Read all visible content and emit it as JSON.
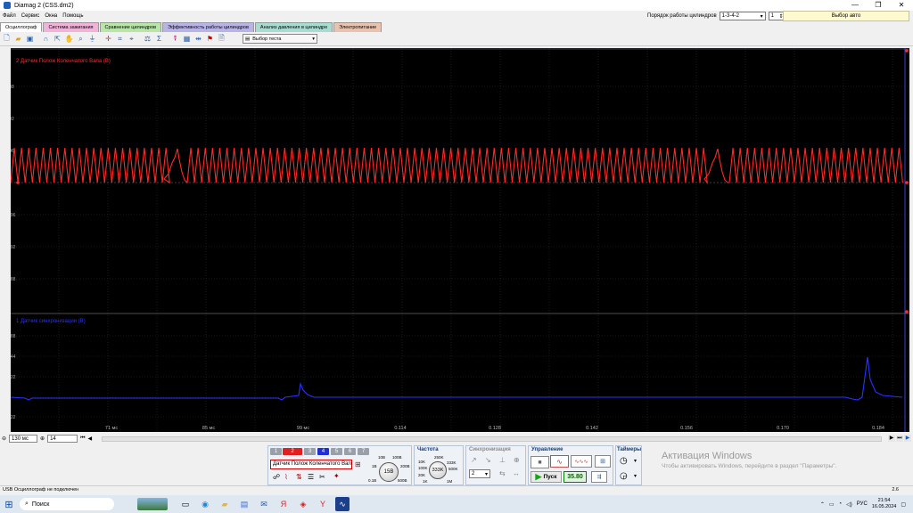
{
  "window": {
    "title": "Diamag 2 (CSS.dm2)",
    "minimize": "—",
    "maximize": "❐",
    "close": "✕"
  },
  "menu": [
    "Файл",
    "Сервис",
    "Окна",
    "Помощь"
  ],
  "cylinder_order": {
    "label": "Порядок работы цилиндров",
    "value": "1-3-4-2",
    "cyl_value": "1"
  },
  "auto_select": "Выбор авто",
  "tabs": [
    {
      "label": "Осциллограф",
      "bg": "#ffffff"
    },
    {
      "label": "Система зажигания",
      "bg": "#f0b4d8"
    },
    {
      "label": "Сравнение цилиндров",
      "bg": "#b8e6a8"
    },
    {
      "label": "Эффективность работы цилиндров",
      "bg": "#b8b4e6"
    },
    {
      "label": "Анализ давления в цилиндре",
      "bg": "#a8dcd0"
    },
    {
      "label": "Электропитание",
      "bg": "#e8c4b0"
    }
  ],
  "toolbar": {
    "test_select": "Выбор теста"
  },
  "scope": {
    "ch1": {
      "label": "2 Датчик Полож Коленчатого Вала (В)",
      "color": "#ff2020",
      "y_ticks": [
        "9.88",
        "5.92",
        "2.96",
        "0",
        "-2.96",
        "-5.92",
        "-8.88"
      ]
    },
    "ch2": {
      "label": "1 Датчик синхронизации (В)",
      "color": "#2a32ff",
      "y_ticks": [
        "-9.88",
        "-6.44",
        "-3.22",
        "0",
        "-3.22"
      ]
    },
    "x_ticks": [
      "71 мс",
      "85 мс",
      "99 мс",
      "0.114",
      "0.128",
      "0.142",
      "0.156",
      "0.170",
      "0.184"
    ]
  },
  "bottom_bar": {
    "timebase": "130 мс",
    "page": "14"
  },
  "controls": {
    "channels": [
      "1",
      "2",
      "3",
      "4",
      "5",
      "6",
      "7"
    ],
    "sensor": "Датчик Полож Коленчатого Вала",
    "amplitude_knob": "15В",
    "amplitude_ticks": [
      "10В",
      "100В",
      "1В",
      "200В",
      "0.1В",
      "500В"
    ],
    "freq_title": "Частота",
    "freq_knob": "333K",
    "freq_ticks": [
      "10K",
      "250K",
      "100K",
      "333K",
      "20K",
      "500K",
      "1K",
      "1M"
    ],
    "sync_title": "Синхронизация",
    "sync_value": "2",
    "manage_title": "Управление",
    "start": "Пуск",
    "fps": "35.80",
    "timers_title": "Таймеры"
  },
  "watermark": {
    "title": "Активация Windows",
    "subtitle": "Чтобы активировать Windows, перейдите в раздел \"Параметры\"."
  },
  "status": {
    "text": "USB Осциллограф не подключен",
    "version": "2.6"
  },
  "taskbar": {
    "search": "Поиск",
    "lang": "РУС",
    "time": "21:54",
    "date": "16.05.2024"
  }
}
